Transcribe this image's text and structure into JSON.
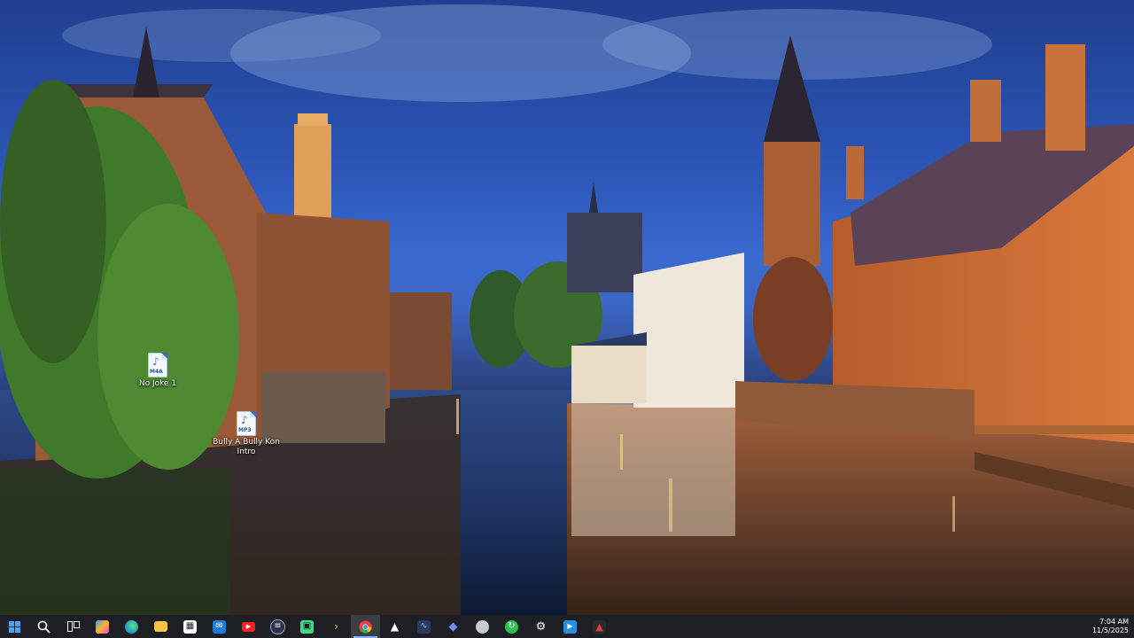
{
  "desktop": {
    "icons": [
      {
        "name": "No Joke 1",
        "ext": "M4A"
      },
      {
        "name": "Bully A Bully Kon Intro",
        "ext": "MP3"
      }
    ]
  },
  "taskbar": {
    "items": [
      {
        "icon": "windows-start-icon",
        "active": false
      },
      {
        "icon": "search-icon",
        "active": false
      },
      {
        "icon": "task-view-icon",
        "active": false
      },
      {
        "icon": "copilot-icon",
        "active": false
      },
      {
        "icon": "edge-icon",
        "active": false
      },
      {
        "icon": "file-explorer-icon",
        "active": false
      },
      {
        "icon": "microsoft-store-icon",
        "active": false
      },
      {
        "icon": "mail-icon",
        "active": false
      },
      {
        "icon": "youtube-icon",
        "active": false
      },
      {
        "icon": "media-player-icon",
        "active": false
      },
      {
        "icon": "android-app-icon",
        "active": false
      },
      {
        "icon": "terminal-icon",
        "active": false
      },
      {
        "icon": "chrome-icon",
        "active": true
      },
      {
        "icon": "triangle-app-icon",
        "active": false
      },
      {
        "icon": "audio-editor-icon",
        "active": false
      },
      {
        "icon": "diamond-app-icon",
        "active": false
      },
      {
        "icon": "shield-app-icon",
        "active": false
      },
      {
        "icon": "green-app-icon",
        "active": false
      },
      {
        "icon": "settings-gear-icon",
        "active": false
      },
      {
        "icon": "video-player-icon",
        "active": false
      },
      {
        "icon": "red-app-icon",
        "active": false
      }
    ],
    "colors": {
      "windows": "#4aa3ff",
      "edge": "#1fa0c8",
      "explorer": "#f4c542",
      "youtube": "#ff1f1f",
      "chrome": "#e94235",
      "green": "#2fbf4f",
      "accent": "#7fb4ff"
    },
    "clock": {
      "time": "7:04 AM",
      "date": "11/5/2025"
    }
  }
}
